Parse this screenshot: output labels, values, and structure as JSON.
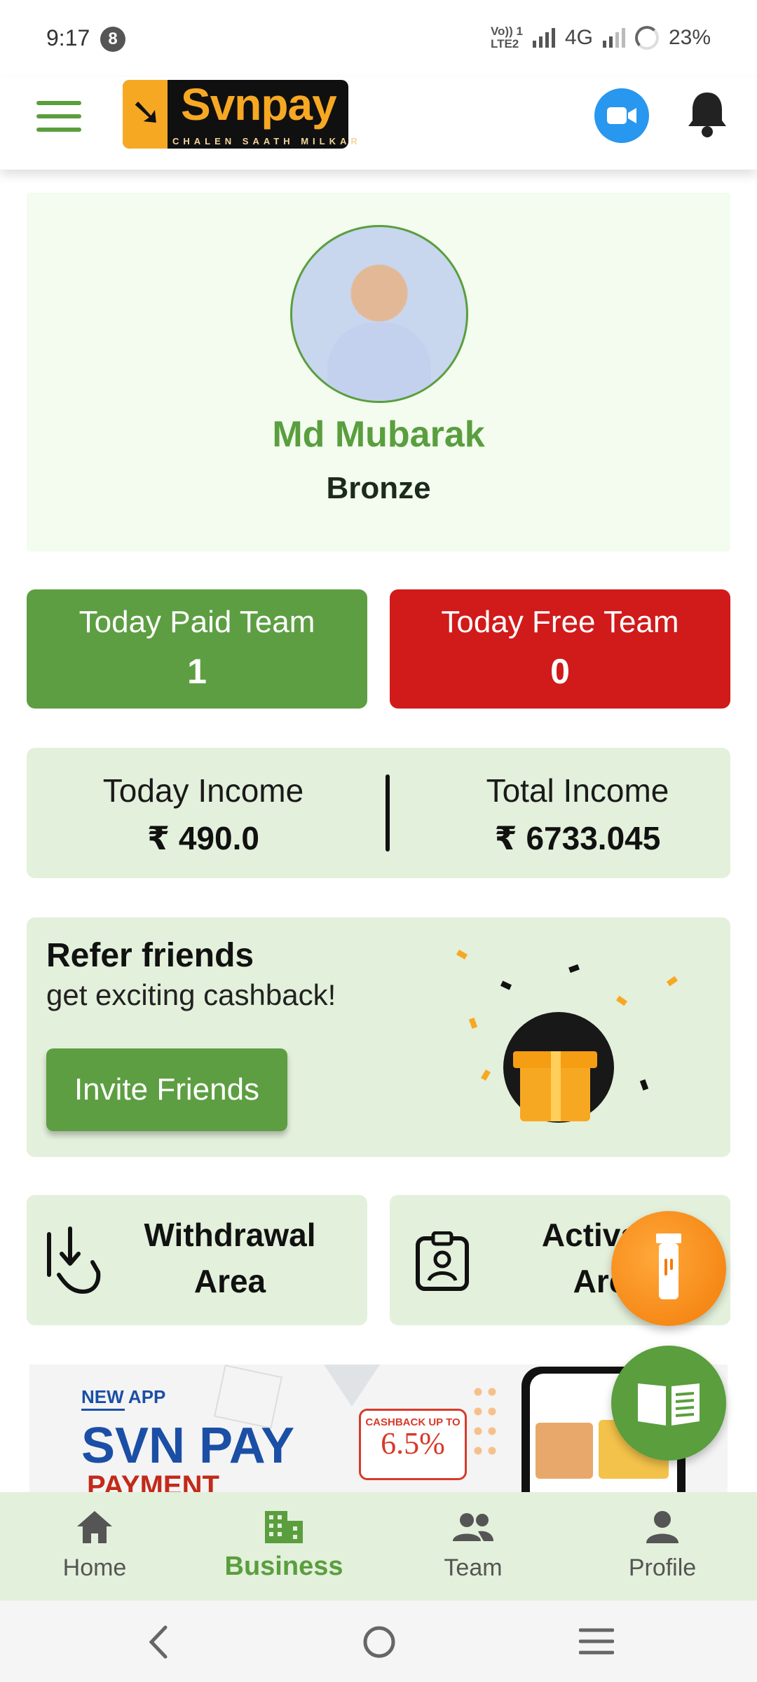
{
  "status_bar": {
    "time": "9:17",
    "notification_count": "8",
    "volte": "Vo)) 1",
    "lte": "LTE2",
    "network": "4G",
    "battery": "23%"
  },
  "header": {
    "menu_icon": "hamburger-menu-icon",
    "logo_text": "Svnpay",
    "logo_tagline": "CHALEN SAATH MILKAR",
    "video_icon": "video-camera-icon",
    "bell_icon": "bell-icon",
    "accent_color": "#5a9e3e"
  },
  "profile": {
    "name": "Md Mubarak",
    "rank": "Bronze"
  },
  "stats": {
    "paid": {
      "label": "Today Paid Team",
      "value": "1",
      "color": "#5d9e42"
    },
    "free": {
      "label": "Today Free Team",
      "value": "0",
      "color": "#d11a1a"
    }
  },
  "income": {
    "today_label": "Today Income",
    "today_value": "₹ 490.0",
    "total_label": "Total Income",
    "total_value": "₹ 6733.045"
  },
  "refer": {
    "title": "Refer friends",
    "subtitle": "get exciting cashback!",
    "button": "Invite Friends"
  },
  "actions": {
    "withdrawal_line1": "Withdrawal",
    "withdrawal_line2": "Area",
    "activation_line1": "Activati",
    "activation_line2": "Are"
  },
  "banner": {
    "tag": "NEW APP",
    "title": "SVN PAY",
    "subtitle": "PAYMENT",
    "cashback_label": "CASHBACK UP TO",
    "cashback_value": "6.5%"
  },
  "nav": {
    "items": [
      {
        "label": "Home",
        "icon": "home-icon"
      },
      {
        "label": "Business",
        "icon": "building-icon",
        "active": true
      },
      {
        "label": "Team",
        "icon": "team-icon"
      },
      {
        "label": "Profile",
        "icon": "person-icon"
      }
    ]
  }
}
